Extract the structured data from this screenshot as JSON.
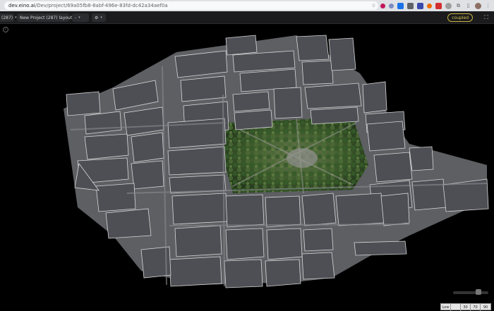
{
  "browser": {
    "url_host": "dev.eino.ai",
    "url_path": "/Dev/project/69a05fb8-8abf-496e-83fd-dc42a34aef0a"
  },
  "toolbar": {
    "project_count": "(287)",
    "layout_label": "New Project (287) layout",
    "view_select": "-",
    "coupled_label": "coupled"
  },
  "scale": {
    "labels": [
      "Low",
      "",
      "30",
      "70",
      "90"
    ]
  },
  "colors": {
    "building_fill": "#4e4f55",
    "building_stroke": "#d8d8d8",
    "accent": "#c9b341"
  }
}
